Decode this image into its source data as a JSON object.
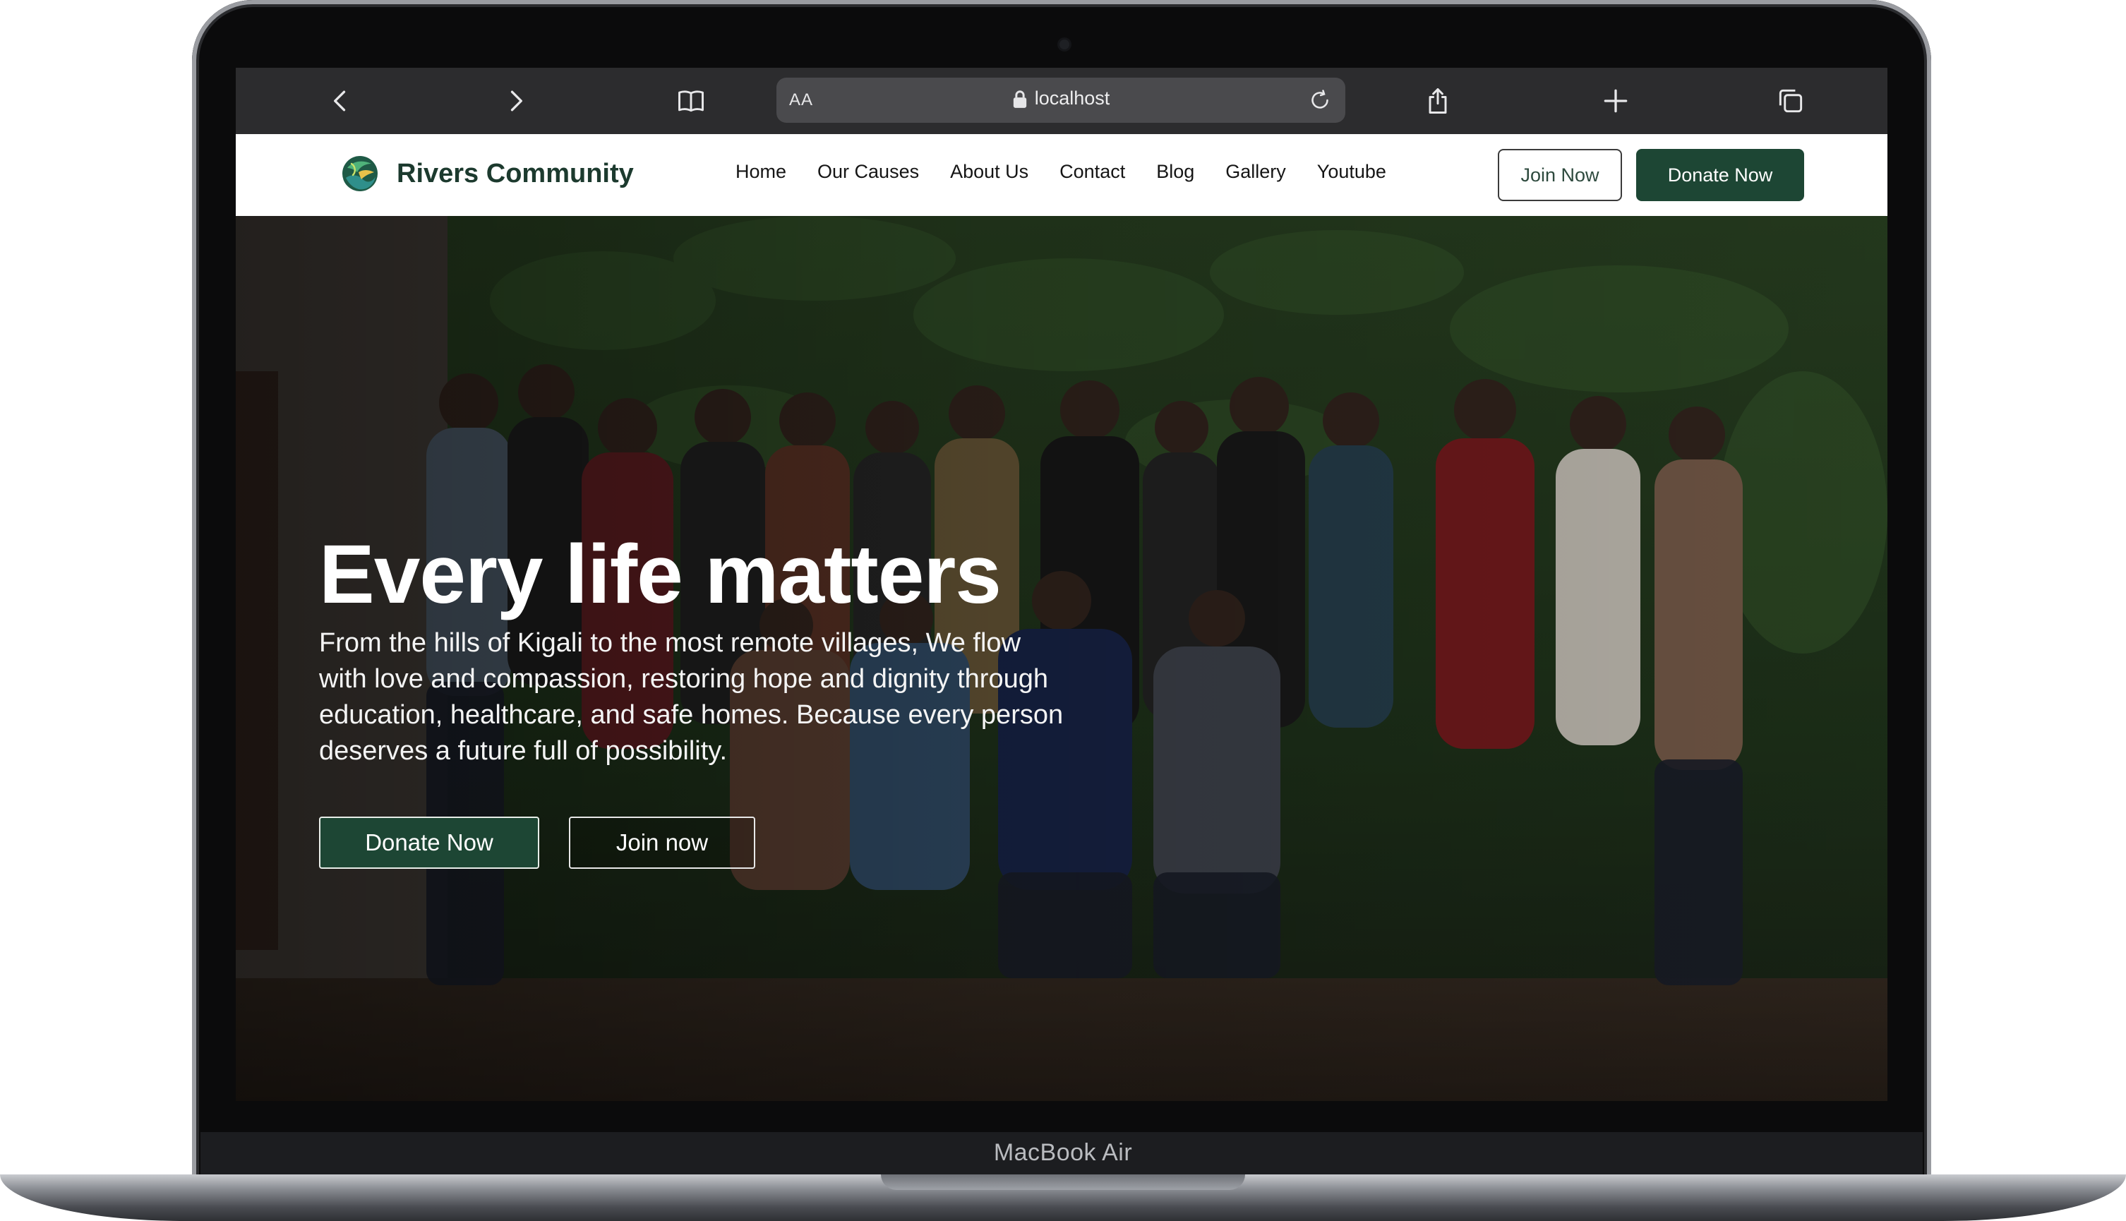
{
  "browser": {
    "aa_label": "AA",
    "url": "localhost",
    "icons": [
      "back-icon",
      "forward-icon",
      "bookmarks-icon",
      "lock-icon",
      "reload-icon",
      "share-icon",
      "new-tab-icon",
      "tabs-icon"
    ]
  },
  "site": {
    "brand_name": "Rivers Community",
    "nav": [
      "Home",
      "Our Causes",
      "About Us",
      "Contact",
      "Blog",
      "Gallery",
      "Youtube"
    ],
    "join_label": "Join Now",
    "donate_label": "Donate Now",
    "colors": {
      "brand_green": "#1d4634",
      "text_dark": "#151515"
    }
  },
  "hero": {
    "title": "Every life matters",
    "text": "From the hills of Kigali to the most remote villages, We flow with love and compassion, restoring hope and dignity through education, healthcare, and safe homes. Because every person deserves a future full of possibility.",
    "donate_label": "Donate Now",
    "join_label": "Join now"
  },
  "device": {
    "label": "MacBook Air"
  }
}
